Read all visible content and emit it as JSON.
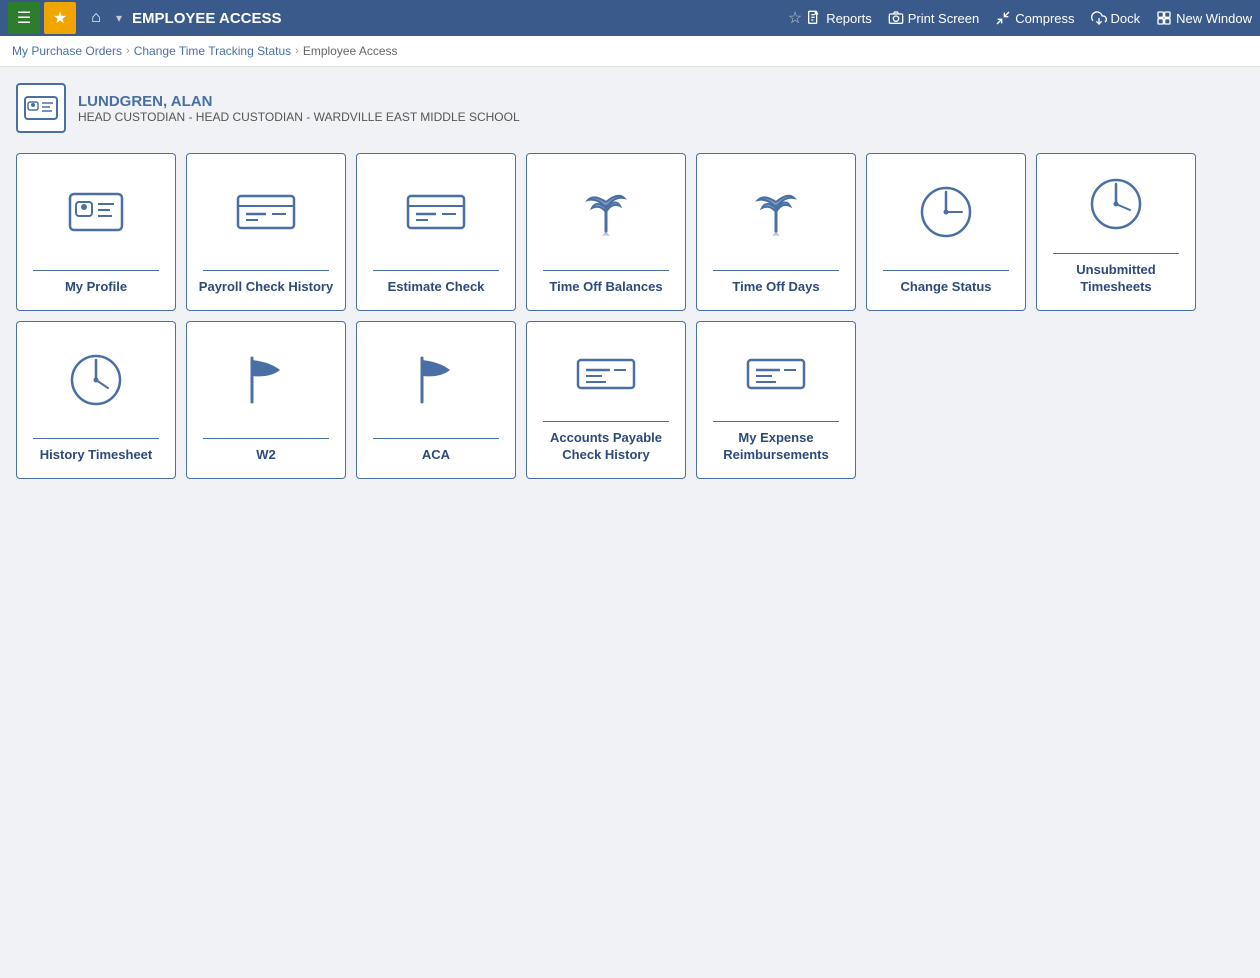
{
  "topbar": {
    "title": "EMPLOYEE ACCESS",
    "star_label": "★",
    "actions": [
      {
        "id": "reports",
        "label": "Reports",
        "icon": "document-icon"
      },
      {
        "id": "print-screen",
        "label": "Print Screen",
        "icon": "camera-icon"
      },
      {
        "id": "compress",
        "label": "Compress",
        "icon": "compress-icon"
      },
      {
        "id": "dock",
        "label": "Dock",
        "icon": "dock-icon"
      },
      {
        "id": "new-window",
        "label": "New Window",
        "icon": "newwindow-icon"
      }
    ]
  },
  "breadcrumb": {
    "items": [
      {
        "label": "My Purchase Orders",
        "link": true
      },
      {
        "label": "Change Time Tracking Status",
        "link": true
      },
      {
        "label": "Employee Access",
        "link": false
      }
    ]
  },
  "user": {
    "name": "LUNDGREN, ALAN",
    "title": "HEAD CUSTODIAN - HEAD CUSTODIAN - WARDVILLE EAST MIDDLE SCHOOL"
  },
  "tiles": [
    {
      "id": "my-profile",
      "label": "My Profile",
      "icon": "id-card"
    },
    {
      "id": "payroll-check-history",
      "label": "Payroll Check History",
      "icon": "check"
    },
    {
      "id": "estimate-check",
      "label": "Estimate Check",
      "icon": "check"
    },
    {
      "id": "time-off-balances",
      "label": "Time Off Balances",
      "icon": "palm-tree"
    },
    {
      "id": "time-off-days",
      "label": "Time Off Days",
      "icon": "palm-tree"
    },
    {
      "id": "change-status",
      "label": "Change Status",
      "icon": "clock"
    },
    {
      "id": "unsubmitted-timesheets",
      "label": "Unsubmitted Timesheets",
      "icon": "clock"
    },
    {
      "id": "history-timesheet",
      "label": "History Timesheet",
      "icon": "clock"
    },
    {
      "id": "w2",
      "label": "W2",
      "icon": "flag"
    },
    {
      "id": "aca",
      "label": "ACA",
      "icon": "flag"
    },
    {
      "id": "accounts-payable",
      "label": "Accounts Payable Check History",
      "icon": "check-list"
    },
    {
      "id": "my-expense",
      "label": "My Expense Reimbursements",
      "icon": "check-list"
    }
  ]
}
